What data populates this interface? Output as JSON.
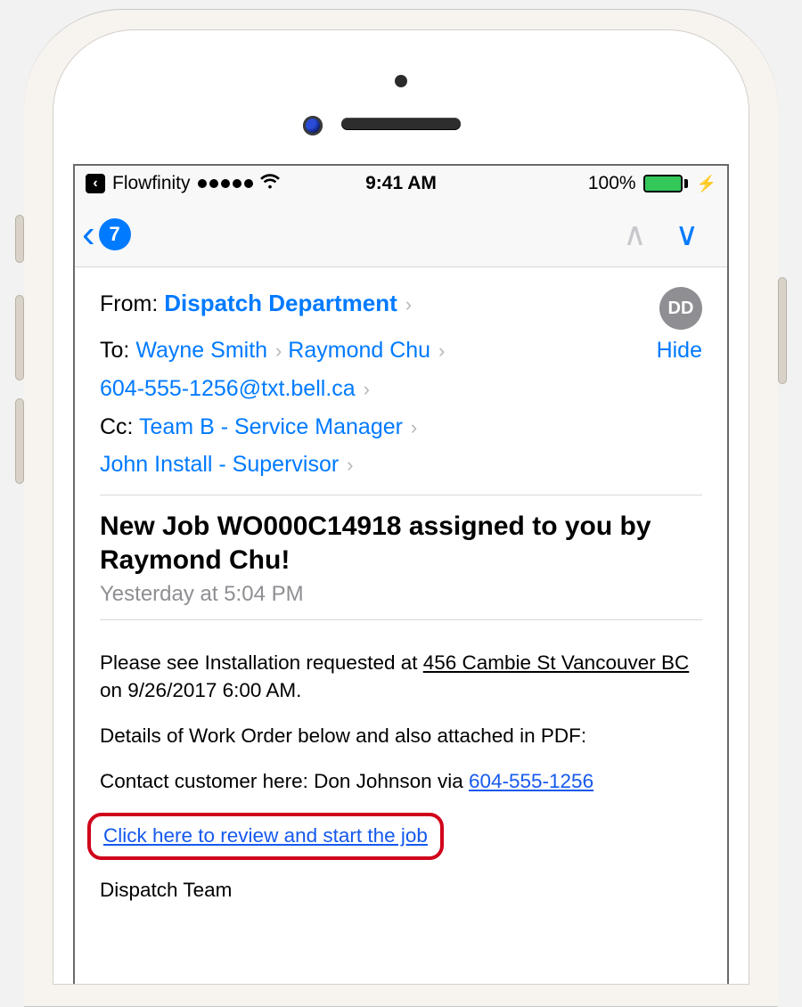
{
  "status": {
    "back_app_label": "Flowfinity",
    "time": "9:41 AM",
    "battery_pct": "100%"
  },
  "nav": {
    "unread_badge": "7"
  },
  "header": {
    "from_label": "From:",
    "from_name": "Dispatch Department",
    "avatar_initials": "DD",
    "to_label": "To:",
    "to": [
      "Wayne Smith",
      "Raymond Chu"
    ],
    "to_extra": "604-555-1256@txt.bell.ca",
    "hide_label": "Hide",
    "cc_label": "Cc:",
    "cc": [
      "Team B - Service Manager",
      "John Install - Supervisor"
    ]
  },
  "message": {
    "subject": "New Job WO000C14918 assigned to you by Raymond Chu!",
    "timestamp": "Yesterday at 5:04 PM",
    "body": {
      "line1_pre": "Please see Installation requested at ",
      "line1_addr": "456 Cambie St Vancouver BC",
      "line1_post": " on 9/26/2017 6:00 AM.",
      "line2": "Details of Work Order below and also attached in PDF:",
      "line3_pre": "Contact customer here: Don Johnson via ",
      "line3_phone": "604-555-1256",
      "cta": "Click here to review and start the job",
      "signature": "Dispatch Team"
    }
  }
}
